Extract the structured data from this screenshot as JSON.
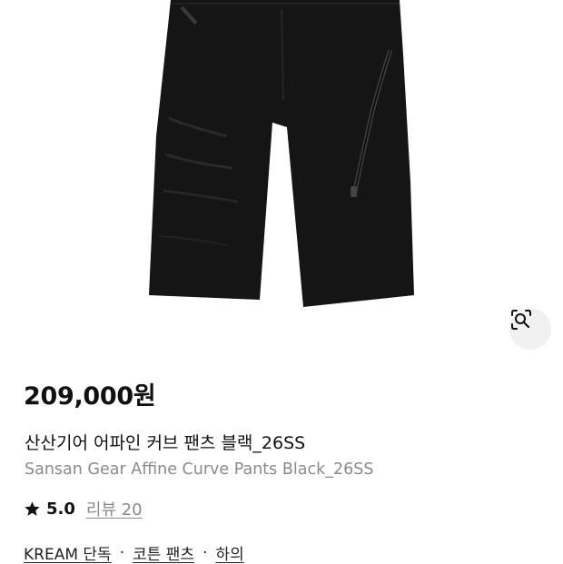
{
  "product": {
    "price": "209,000원",
    "name_ko": "산산기어 어파인 커브 팬츠 블랙_26SS",
    "name_en": "Sansan Gear Affine Curve Pants Black_26SS",
    "rating": "5.0",
    "review_label": "리뷰 20",
    "tags": [
      "KREAM 단독",
      "코튼 팬츠",
      "하의"
    ],
    "separator": "·"
  },
  "icons": {
    "lens": "image-search-icon",
    "star": "star-icon"
  },
  "colors": {
    "primary_text": "#111111",
    "secondary_text": "#8a8a8a",
    "lens_bg": "#f1f1f1",
    "garment": "#151515"
  }
}
